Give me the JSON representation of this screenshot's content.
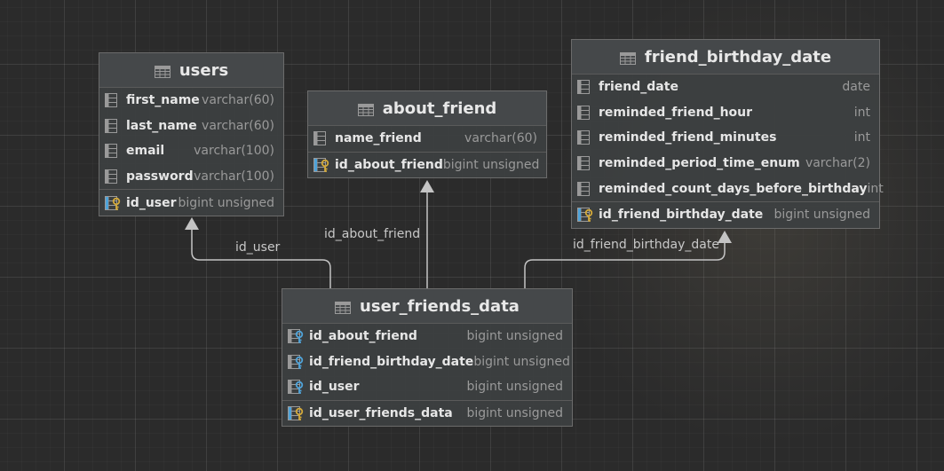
{
  "tables": {
    "users": {
      "name": "users",
      "columns": [
        {
          "name": "first_name",
          "type": "varchar(60)"
        },
        {
          "name": "last_name",
          "type": "varchar(60)"
        },
        {
          "name": "email",
          "type": "varchar(100)"
        },
        {
          "name": "password",
          "type": "varchar(100)"
        }
      ],
      "keys": [
        {
          "name": "id_user",
          "type": "bigint unsigned"
        }
      ]
    },
    "about_friend": {
      "name": "about_friend",
      "columns": [
        {
          "name": "name_friend",
          "type": "varchar(60)"
        }
      ],
      "keys": [
        {
          "name": "id_about_friend",
          "type": "bigint unsigned"
        }
      ]
    },
    "friend_birthday_date": {
      "name": "friend_birthday_date",
      "columns": [
        {
          "name": "friend_date",
          "type": "date"
        },
        {
          "name": "reminded_friend_hour",
          "type": "int"
        },
        {
          "name": "reminded_friend_minutes",
          "type": "int"
        },
        {
          "name": "reminded_period_time_enum",
          "type": "varchar(2)"
        },
        {
          "name": "reminded_count_days_before_birthday",
          "type": "int"
        }
      ],
      "keys": [
        {
          "name": "id_friend_birthday_date",
          "type": "bigint unsigned"
        }
      ]
    },
    "user_friends_data": {
      "name": "user_friends_data",
      "columns": [
        {
          "name": "id_about_friend",
          "type": "bigint unsigned"
        },
        {
          "name": "id_friend_birthday_date",
          "type": "bigint unsigned"
        },
        {
          "name": "id_user",
          "type": "bigint unsigned"
        }
      ],
      "keys": [
        {
          "name": "id_user_friends_data",
          "type": "bigint unsigned"
        }
      ]
    }
  },
  "links": {
    "id_user": "id_user",
    "id_about_friend": "id_about_friend",
    "id_friend_birthday_date": "id_friend_birthday_date"
  },
  "colors": {
    "line": "#c4c4c4",
    "key_gold": "#d3a93a",
    "key_blue": "#4fa3d9",
    "icon_gray": "#9a9a9a"
  },
  "icons": {
    "table": "table-icon",
    "column": "column-icon",
    "foreign_key": "foreign-key-icon",
    "primary_key": "primary-key-icon"
  }
}
